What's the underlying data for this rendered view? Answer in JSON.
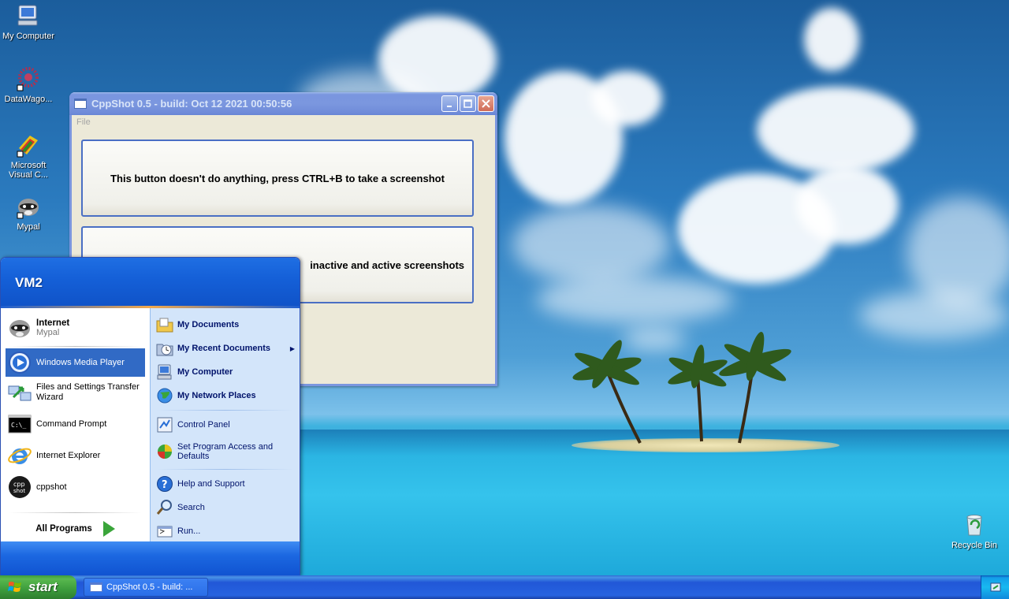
{
  "desktop": {
    "icons": [
      {
        "label": "My Computer",
        "icon": "my-computer-icon"
      },
      {
        "label": "DataWago...",
        "icon": "datawagon-icon"
      },
      {
        "label": "Microsoft Visual C...",
        "icon": "visual-c-icon"
      },
      {
        "label": "Mypal",
        "icon": "mypal-icon"
      },
      {
        "label": "Recycle Bin",
        "icon": "recycle-bin-icon"
      }
    ]
  },
  "window": {
    "title": "CppShot 0.5 - build: Oct 12 2021 00:50:56",
    "menu": [
      "File"
    ],
    "button1_label": "This button doesn't do anything, press CTRL+B to take a screenshot",
    "button2_label": "inactive and active screenshots"
  },
  "start_menu": {
    "user": "VM2",
    "pinned": [
      {
        "primary": "Internet",
        "secondary": "Mypal",
        "icon": "mypal-icon"
      }
    ],
    "recent": [
      {
        "label": "Windows Media Player",
        "icon": "media-player-icon",
        "selected": true
      },
      {
        "label": "Files and Settings Transfer Wizard",
        "icon": "transfer-wizard-icon"
      },
      {
        "label": "Command Prompt",
        "icon": "command-prompt-icon"
      },
      {
        "label": "Internet Explorer",
        "icon": "internet-explorer-icon"
      },
      {
        "label": "cppshot",
        "icon": "cppshot-icon"
      }
    ],
    "all_programs": "All Programs",
    "places": [
      {
        "label": "My Documents",
        "icon": "my-documents-icon"
      },
      {
        "label": "My Recent Documents",
        "icon": "recent-documents-icon",
        "submenu": true
      },
      {
        "label": "My Computer",
        "icon": "my-computer-icon"
      },
      {
        "label": "My Network Places",
        "icon": "network-places-icon"
      }
    ],
    "system": [
      {
        "label": "Control Panel",
        "icon": "control-panel-icon"
      },
      {
        "label": "Set Program Access and Defaults",
        "icon": "program-access-icon"
      }
    ],
    "help": [
      {
        "label": "Help and Support",
        "icon": "help-icon"
      },
      {
        "label": "Search",
        "icon": "search-icon"
      },
      {
        "label": "Run...",
        "icon": "run-icon"
      }
    ]
  },
  "taskbar": {
    "start_label": "start",
    "task_label": "CppShot 0.5 - build: ..."
  }
}
